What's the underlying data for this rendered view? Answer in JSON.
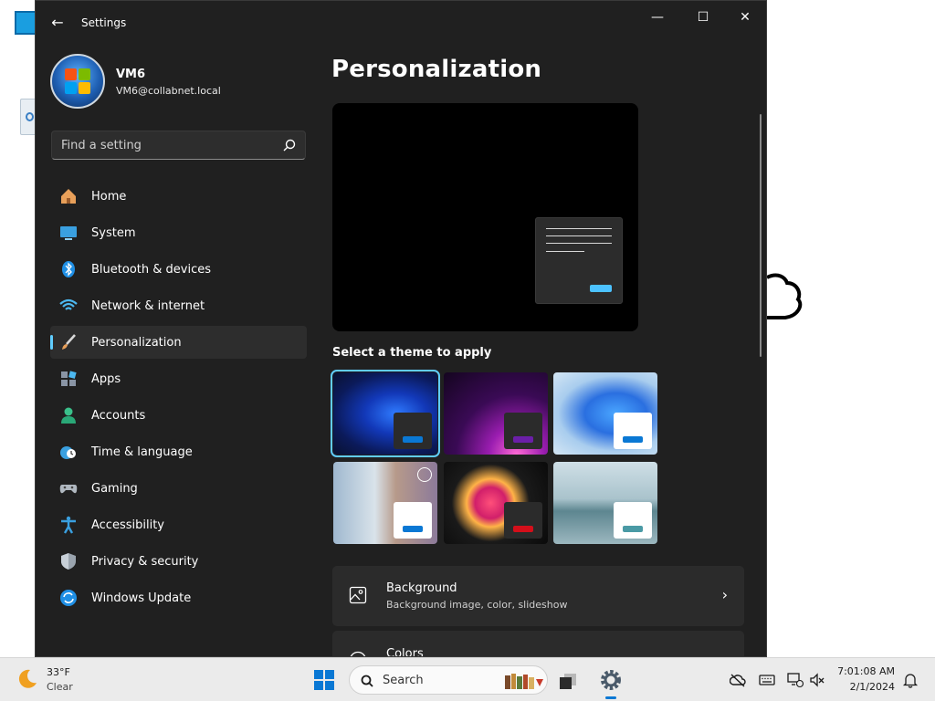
{
  "window": {
    "title": "Settings",
    "controls": {
      "minimize": "—",
      "maximize": "☐",
      "close": "✕"
    }
  },
  "profile": {
    "name": "VM6",
    "email": "VM6@collabnet.local"
  },
  "search": {
    "placeholder": "Find a setting"
  },
  "nav": [
    {
      "label": "Home",
      "icon": "home-icon",
      "active": false
    },
    {
      "label": "System",
      "icon": "system-icon",
      "active": false
    },
    {
      "label": "Bluetooth & devices",
      "icon": "bluetooth-icon",
      "active": false
    },
    {
      "label": "Network & internet",
      "icon": "wifi-icon",
      "active": false
    },
    {
      "label": "Personalization",
      "icon": "brush-icon",
      "active": true
    },
    {
      "label": "Apps",
      "icon": "apps-icon",
      "active": false
    },
    {
      "label": "Accounts",
      "icon": "person-icon",
      "active": false
    },
    {
      "label": "Time & language",
      "icon": "clock-globe-icon",
      "active": false
    },
    {
      "label": "Gaming",
      "icon": "gamepad-icon",
      "active": false
    },
    {
      "label": "Accessibility",
      "icon": "accessibility-icon",
      "active": false
    },
    {
      "label": "Privacy & security",
      "icon": "shield-icon",
      "active": false
    },
    {
      "label": "Windows Update",
      "icon": "update-icon",
      "active": false
    }
  ],
  "main": {
    "title": "Personalization",
    "themes_heading": "Select a theme to apply",
    "themes": [
      {
        "name": "windows-dark",
        "selected": true
      },
      {
        "name": "glow",
        "selected": false
      },
      {
        "name": "windows-light",
        "selected": false
      },
      {
        "name": "windows-spotlight",
        "selected": false
      },
      {
        "name": "captured-motion",
        "selected": false
      },
      {
        "name": "flow",
        "selected": false
      }
    ],
    "cards": [
      {
        "title": "Background",
        "subtitle": "Background image, color, slideshow"
      },
      {
        "title": "Colors",
        "subtitle": ""
      }
    ]
  },
  "taskbar": {
    "weather": {
      "temp": "33°F",
      "condition": "Clear"
    },
    "search_label": "Search",
    "clock": {
      "time": "7:01:08 AM",
      "date": "2/1/2024"
    }
  },
  "colors": {
    "accent": "#60cdff",
    "window_bg": "#202020",
    "taskbar_bg": "#ebebeb"
  }
}
